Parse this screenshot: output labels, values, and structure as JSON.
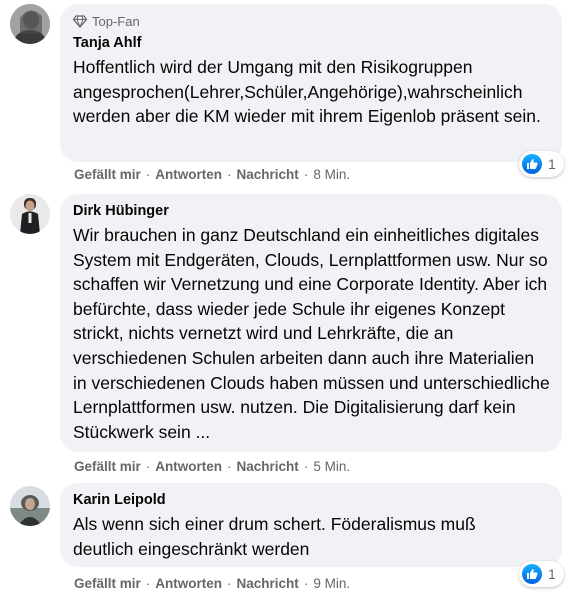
{
  "comments": [
    {
      "badge": "Top-Fan",
      "author": "Tanja Ahlf",
      "text": "Hoffentlich wird der Umgang mit den Risikogruppen angesprochen(Lehrer,Schüler,Angehörige),wahrscheinlich werden aber die KM wieder mit ihrem Eigenlob präsent sein.",
      "like": "Gefällt mir",
      "reply": "Antworten",
      "message": "Nachricht",
      "time": "8 Min.",
      "reaction_count": "1"
    },
    {
      "author": "Dirk Hübinger",
      "text": "Wir brauchen in ganz Deutschland ein einheitliches digitales System mit Endgeräten, Clouds, Lernplattformen usw. Nur so schaffen wir Vernetzung und eine Corporate Identity. Aber ich befürchte, dass wieder jede Schule ihr eigenes Konzept strickt, nichts vernetzt wird und Lehrkräfte, die an verschiedenen Schulen arbeiten dann auch ihre Materialien in verschiedenen Clouds haben müssen und unterschiedliche Lernplattformen usw. nutzen. Die Digitalisierung darf kein Stückwerk sein ...",
      "like": "Gefällt mir",
      "reply": "Antworten",
      "message": "Nachricht",
      "time": "5 Min."
    },
    {
      "author": "Karin Leipold",
      "text": "Als wenn sich einer drum schert. Föderalismus muß deutlich eingeschränkt werden",
      "like": "Gefällt mir",
      "reply": "Antworten",
      "message": "Nachricht",
      "time": "9 Min.",
      "reaction_count": "1"
    }
  ],
  "icons": {
    "badge": "diamond-icon",
    "reaction": "thumbs-up-icon"
  },
  "colors": {
    "bubble": "#f0f2f5",
    "secondary_text": "#65676b",
    "like_blue": "#1877f2"
  }
}
